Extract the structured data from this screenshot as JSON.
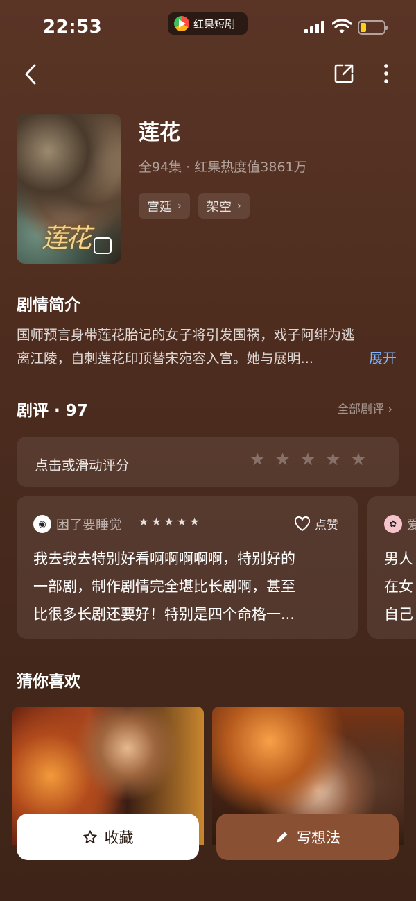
{
  "status_bar": {
    "time": "22:53",
    "app_name": "红果短剧",
    "battery_level": 0.2
  },
  "nav": {
    "back_icon": "chevron-left-icon",
    "share_icon": "share-icon",
    "more_icon": "more-vertical-icon"
  },
  "drama": {
    "title": "莲花",
    "poster_title": "莲花",
    "meta": "全94集 · 红果热度值3861万",
    "tags": [
      {
        "label": "宫廷",
        "chevron": "›"
      },
      {
        "label": "架空",
        "chevron": "›"
      }
    ]
  },
  "synopsis": {
    "heading": "剧情简介",
    "line1": "国师预言身带莲花胎记的女子将引发国祸，戏子阿绯为逃",
    "line2": "离江陵，自刺莲花印顶替宋宛容入宫。她与展明...",
    "expand_label": "展开"
  },
  "reviews": {
    "heading": "剧评 · 97",
    "all_label": "全部剧评 ›",
    "rate_prompt": "点击或滑动评分",
    "rate_stars": 5,
    "items": [
      {
        "reviewer": "困了要睡觉",
        "rating": 5,
        "like_label": "点赞",
        "line1": "我去我去特别好看啊啊啊啊啊，特别好的",
        "line2": "一部剧，制作剧情完全堪比长剧啊，甚至",
        "line3": "比很多长剧还要好！特别是四个命格一..."
      },
      {
        "reviewer": "爱",
        "line1": "男人",
        "line2": "在女",
        "line3": "自己"
      }
    ]
  },
  "recommend": {
    "heading": "猜你喜欢"
  },
  "actions": {
    "favorite_label": "收藏",
    "write_label": "写想法"
  },
  "colors": {
    "background": "#4e2d1f",
    "accent_link": "#7fb4ff",
    "write_button": "#8a5034"
  }
}
